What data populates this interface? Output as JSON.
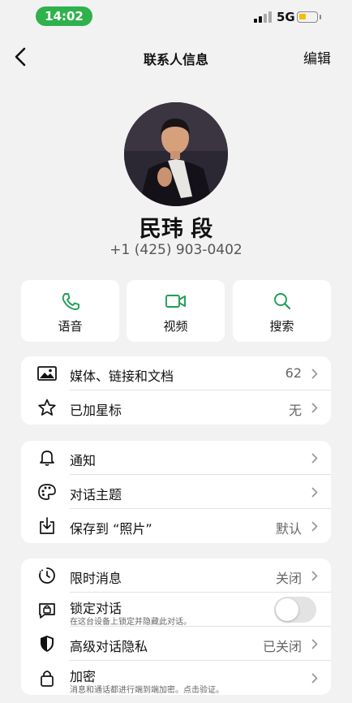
{
  "status_bar": {
    "time": "14:02",
    "network": "5G",
    "time_pill_color": "#2fb14c",
    "battery_color": "#f2c100"
  },
  "nav": {
    "title": "联系人信息",
    "edit": "编辑",
    "back_icon": "chevron-left-icon"
  },
  "profile": {
    "name": "民玮 段",
    "phone": "+1 (425) 903-0402"
  },
  "actions": [
    {
      "label": "语音",
      "icon": "phone-icon"
    },
    {
      "label": "视频",
      "icon": "video-icon"
    },
    {
      "label": "搜索",
      "icon": "search-icon"
    }
  ],
  "accent_color": "#1f9d55",
  "section1": [
    {
      "label": "媒体、链接和文档",
      "value": "62",
      "icon": "image-icon"
    },
    {
      "label": "已加星标",
      "value": "无",
      "icon": "star-icon"
    }
  ],
  "section2": [
    {
      "label": "通知",
      "value": "",
      "icon": "bell-icon"
    },
    {
      "label": "对话主题",
      "value": "",
      "icon": "palette-icon"
    },
    {
      "label": "保存到 “照片”",
      "value": "默认",
      "icon": "download-icon"
    }
  ],
  "section3": [
    {
      "label": "限时消息",
      "value": "关闭",
      "icon": "timer-icon"
    },
    {
      "label": "锁定对话",
      "sub": "在这台设备上锁定并隐藏此对话。",
      "toggle": false,
      "icon": "lock-chat-icon"
    },
    {
      "label": "高级对话隐私",
      "value": "已关闭",
      "icon": "shield-icon"
    },
    {
      "label": "加密",
      "sub": "消息和通话都进行端到端加密。点击验证。",
      "icon": "lock-icon"
    }
  ]
}
